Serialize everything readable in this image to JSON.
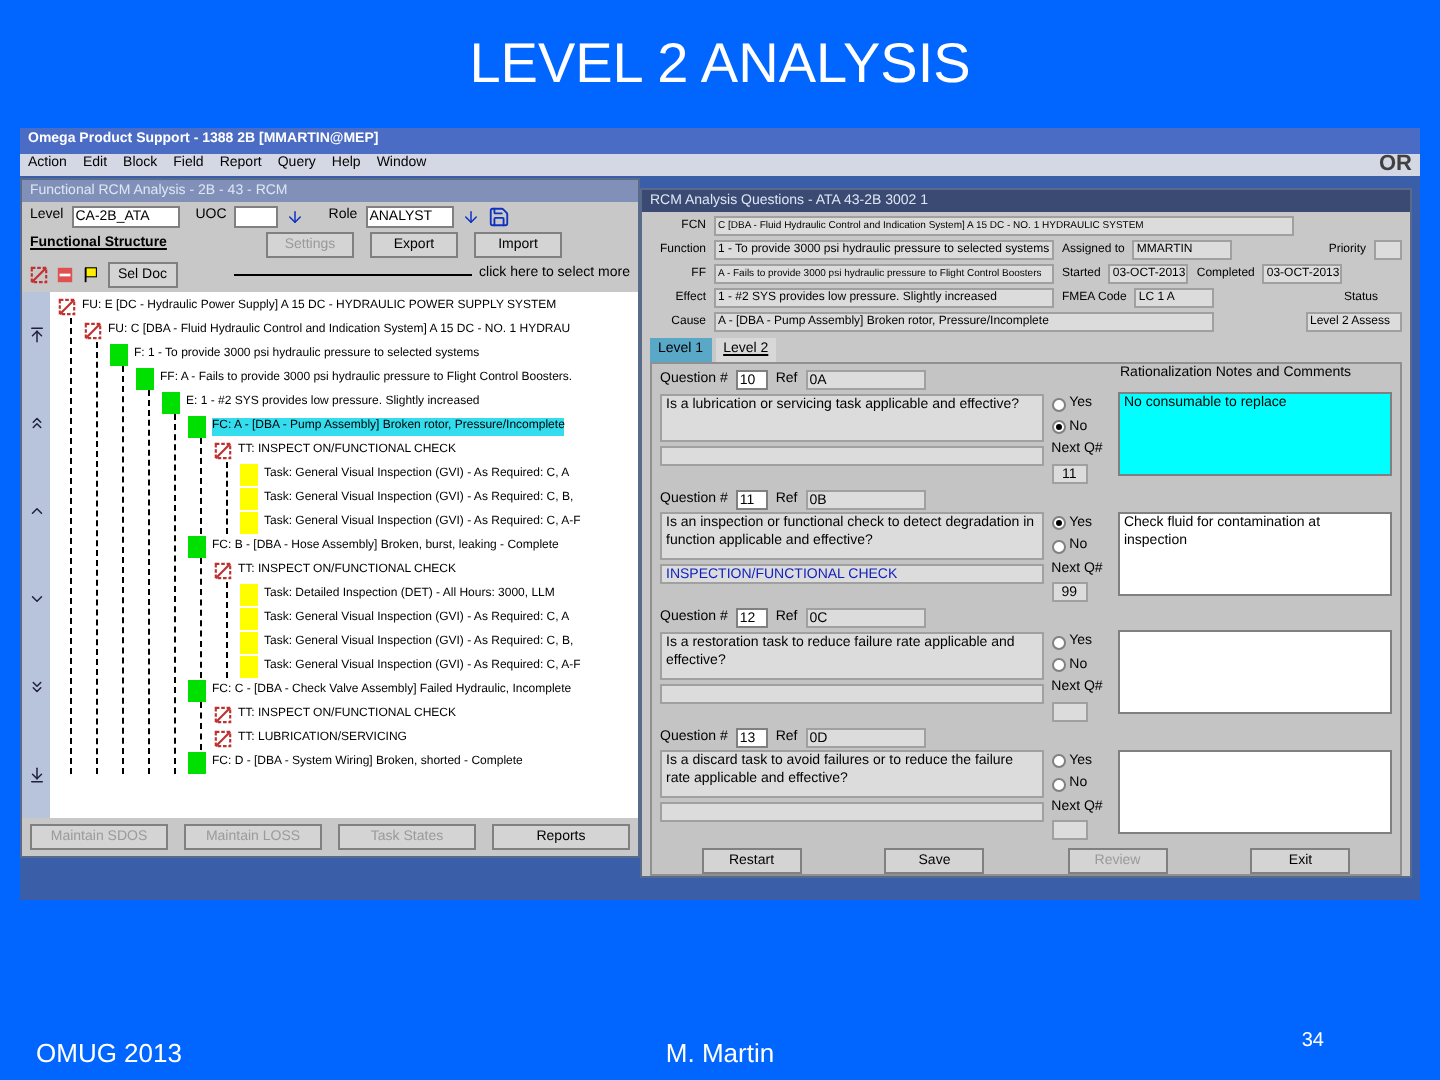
{
  "slide": {
    "title": "LEVEL 2 ANALYSIS",
    "footer_left": "OMUG 2013",
    "footer_center": "M. Martin",
    "page_number": "34"
  },
  "app": {
    "title": "Omega Product Support - 1388 2B [MMARTIN@MEP]",
    "menu": [
      "Action",
      "Edit",
      "Block",
      "Field",
      "Report",
      "Query",
      "Help",
      "Window"
    ],
    "logo_text": "OR"
  },
  "tree_window": {
    "title": "Functional RCM Analysis - 2B - 43 - RCM",
    "level_label": "Level",
    "level_value": "CA-2B_ATA",
    "uoc_label": "UOC",
    "role_label": "Role",
    "role_value": "ANALYST",
    "structure_label": "Functional Structure",
    "buttons": [
      {
        "label": "Settings",
        "disabled": true
      },
      {
        "label": "Export",
        "disabled": false
      },
      {
        "label": "Import",
        "disabled": false
      }
    ],
    "sel_doc": "Sel Doc",
    "hint": "click here to select more",
    "nodes": [
      {
        "kind": "unit",
        "text": "FU: E [DC - Hydraulic Power Supply] A 15 DC - HYDRAULIC POWER SUPPLY SYSTEM",
        "selected": false,
        "children": [
          {
            "kind": "unit",
            "text": "FU: C [DBA - Fluid Hydraulic Control and Indication System] A 15 DC - NO. 1 HYDRAU",
            "selected": false,
            "children": [
              {
                "kind": "item",
                "text": "F: 1 - To provide 3000 psi hydraulic pressure to selected systems",
                "selected": false,
                "children": [
                  {
                    "kind": "item",
                    "text": "FF: A - Fails to provide 3000 psi hydraulic pressure to Flight Control Boosters.",
                    "selected": false,
                    "children": [
                      {
                        "kind": "item",
                        "text": "E: 1 - #2 SYS provides low pressure. Slightly increased",
                        "selected": false,
                        "children": [
                          {
                            "kind": "item",
                            "text": "FC: A - [DBA - Pump Assembly] Broken rotor, Pressure/Incomplete",
                            "selected": true,
                            "children": [
                              {
                                "kind": "unit",
                                "text": "TT: INSPECT ON/FUNCTIONAL CHECK",
                                "selected": false,
                                "children": [
                                  {
                                    "kind": "task",
                                    "text": "Task: General Visual Inspection (GVI) - As Required: C, A",
                                    "selected": false
                                  },
                                  {
                                    "kind": "task",
                                    "text": "Task: General Visual Inspection (GVI) - As Required: C, B,",
                                    "selected": false
                                  },
                                  {
                                    "kind": "task",
                                    "text": "Task: General Visual Inspection (GVI) - As Required: C, A-F",
                                    "selected": false
                                  }
                                ]
                              }
                            ]
                          },
                          {
                            "kind": "item",
                            "text": "FC: B - [DBA - Hose Assembly] Broken, burst, leaking - Complete",
                            "selected": false,
                            "children": [
                              {
                                "kind": "unit",
                                "text": "TT: INSPECT ON/FUNCTIONAL CHECK",
                                "selected": false,
                                "children": [
                                  {
                                    "kind": "task",
                                    "text": "Task: Detailed Inspection (DET) - All Hours: 3000, LLM",
                                    "selected": false
                                  },
                                  {
                                    "kind": "task",
                                    "text": "Task: General Visual Inspection (GVI) - As Required: C, A",
                                    "selected": false
                                  },
                                  {
                                    "kind": "task",
                                    "text": "Task: General Visual Inspection (GVI) - As Required: C, B,",
                                    "selected": false
                                  },
                                  {
                                    "kind": "task",
                                    "text": "Task: General Visual Inspection (GVI) - As Required: C, A-F",
                                    "selected": false
                                  }
                                ]
                              }
                            ]
                          },
                          {
                            "kind": "item",
                            "text": "FC: C - [DBA - Check Valve Assembly] Failed Hydraulic, Incomplete",
                            "selected": false,
                            "children": [
                              {
                                "kind": "unit",
                                "text": "TT: INSPECT ON/FUNCTIONAL CHECK",
                                "selected": false
                              },
                              {
                                "kind": "unit",
                                "text": "TT: LUBRICATION/SERVICING",
                                "selected": false
                              }
                            ]
                          },
                          {
                            "kind": "item",
                            "text": "FC: D - [DBA - System Wiring] Broken, shorted - Complete",
                            "selected": false
                          }
                        ]
                      }
                    ]
                  }
                ]
              }
            ]
          }
        ]
      }
    ],
    "footer_buttons": [
      {
        "label": "Maintain SDOS",
        "disabled": true
      },
      {
        "label": "Maintain LOSS",
        "disabled": true
      },
      {
        "label": "Task States",
        "disabled": true
      },
      {
        "label": "Reports",
        "disabled": false
      }
    ]
  },
  "question_window": {
    "title": "RCM Analysis Questions - ATA 43-2B 3002 1",
    "fields": [
      {
        "label": "FCN",
        "value": "C [DBA - Fluid Hydraulic Control and Indication System] A 15 DC - NO. 1 HYDRAULIC SYSTEM"
      },
      {
        "label": "Function",
        "value": "1 - To provide 3000 psi hydraulic pressure to selected systems"
      },
      {
        "label": "FF",
        "value": "A - Fails to provide 3000 psi hydraulic pressure to Flight Control Boosters"
      },
      {
        "label": "Effect",
        "value": "1 - #2 SYS provides low pressure. Slightly increased"
      },
      {
        "label": "Cause",
        "value": "A - [DBA - Pump Assembly] Broken rotor, Pressure/Incomplete"
      }
    ],
    "assigned_label": "Assigned to",
    "assigned_value": "MMARTIN",
    "priority_label": "Priority",
    "started_label": "Started",
    "started_value": "03-OCT-2013",
    "completed_label": "Completed",
    "completed_value": "03-OCT-2013",
    "fmea_label": "FMEA Code",
    "fmea_value": "LC 1 A",
    "status_label": "Status",
    "status_value": "Level 2 Assess",
    "tabs": [
      {
        "label": "Level 1",
        "selected": true
      },
      {
        "label": "Level 2",
        "selected": false
      }
    ],
    "notes_heading": "Rationalization Notes and Comments",
    "questions": [
      {
        "label": "Question #",
        "number": "10",
        "ref_label": "Ref",
        "ref": "0A",
        "text": "Is a lubrication or servicing task applicable and effective?",
        "options": [
          {
            "label": "Yes",
            "selected": false
          },
          {
            "label": "No",
            "selected": true
          }
        ],
        "next_label": "Next Q#",
        "next": "11",
        "notes": "No consumable to replace",
        "highlighted": true
      },
      {
        "label": "Question #",
        "number": "11",
        "ref_label": "Ref",
        "ref": "0B",
        "text": "Is an inspection or functional check to detect degradation in function applicable and effective?",
        "result": "INSPECTION/FUNCTIONAL CHECK",
        "options": [
          {
            "label": "Yes",
            "selected": true
          },
          {
            "label": "No",
            "selected": false
          }
        ],
        "next_label": "Next Q#",
        "next": "99",
        "notes": "Check fluid for contamination at inspection",
        "highlighted": false
      },
      {
        "label": "Question #",
        "number": "12",
        "ref_label": "Ref",
        "ref": "0C",
        "text": "Is a restoration task to reduce failure rate applicable and effective?",
        "options": [
          {
            "label": "Yes",
            "selected": false
          },
          {
            "label": "No",
            "selected": false
          }
        ],
        "next_label": "Next Q#",
        "highlighted": false
      },
      {
        "label": "Question #",
        "number": "13",
        "ref_label": "Ref",
        "ref": "0D",
        "text": "Is a discard task to avoid failures or to reduce the failure rate applicable and effective?",
        "options": [
          {
            "label": "Yes",
            "selected": false
          },
          {
            "label": "No",
            "selected": false
          }
        ],
        "next_label": "Next Q#",
        "highlighted": false
      }
    ],
    "buttons": [
      {
        "label": "Restart",
        "disabled": false
      },
      {
        "label": "Save",
        "disabled": false
      },
      {
        "label": "Review",
        "disabled": true
      },
      {
        "label": "Exit",
        "disabled": false
      }
    ]
  }
}
